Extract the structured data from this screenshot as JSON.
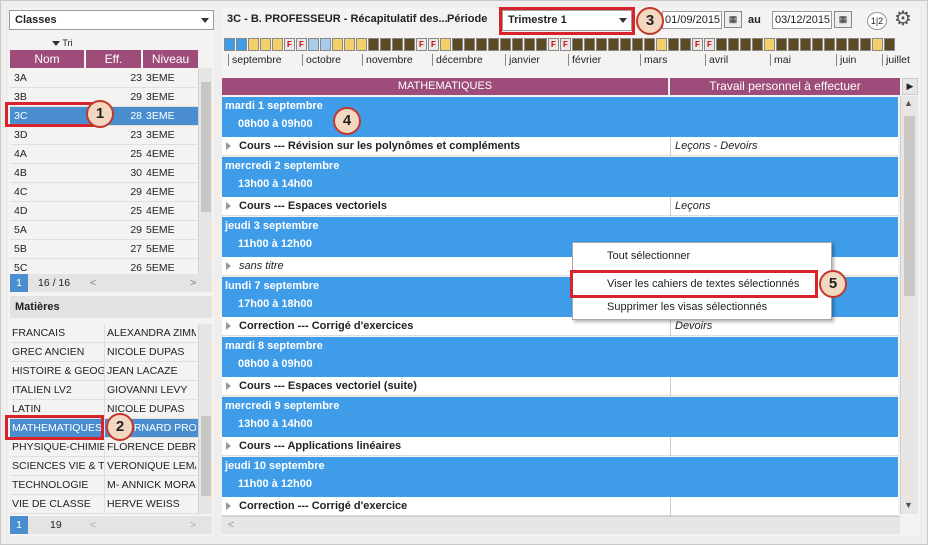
{
  "classes": {
    "dropdown_label": "Classes",
    "sort_label": "Tri",
    "columns": [
      "Nom",
      "Eff.",
      "Niveau"
    ],
    "rows": [
      {
        "nom": "3A",
        "eff": "23",
        "niveau": "3EME"
      },
      {
        "nom": "3B",
        "eff": "29",
        "niveau": "3EME"
      },
      {
        "nom": "3C",
        "eff": "28",
        "niveau": "3EME"
      },
      {
        "nom": "3D",
        "eff": "23",
        "niveau": "3EME"
      },
      {
        "nom": "4A",
        "eff": "25",
        "niveau": "4EME"
      },
      {
        "nom": "4B",
        "eff": "30",
        "niveau": "4EME"
      },
      {
        "nom": "4C",
        "eff": "29",
        "niveau": "4EME"
      },
      {
        "nom": "4D",
        "eff": "25",
        "niveau": "4EME"
      },
      {
        "nom": "5A",
        "eff": "29",
        "niveau": "5EME"
      },
      {
        "nom": "5B",
        "eff": "27",
        "niveau": "5EME"
      },
      {
        "nom": "5C",
        "eff": "26",
        "niveau": "5EME"
      }
    ],
    "selected_index": 2,
    "footer_selected": "1",
    "footer_count": "16 / 16"
  },
  "matieres": {
    "header": "Matières",
    "rows": [
      {
        "matiere": "FRANCAIS",
        "prof": "ALEXANDRA ZIMM"
      },
      {
        "matiere": "GREC ANCIEN",
        "prof": "NICOLE DUPAS"
      },
      {
        "matiere": "HISTOIRE & GEOG",
        "prof": "JEAN LACAZE"
      },
      {
        "matiere": "ITALIEN LV2",
        "prof": "GIOVANNI LEVY"
      },
      {
        "matiere": "LATIN",
        "prof": "NICOLE DUPAS"
      },
      {
        "matiere": "MATHEMATIQUES",
        "prof": "B. BERNARD PROFES"
      },
      {
        "matiere": "PHYSIQUE-CHIMIE",
        "prof": "FLORENCE DEBRA"
      },
      {
        "matiere": "SCIENCES VIE & T",
        "prof": "VERONIQUE LEMA"
      },
      {
        "matiere": "TECHNOLOGIE",
        "prof": "M- ANNICK MORAI"
      },
      {
        "matiere": "VIE DE CLASSE",
        "prof": "HERVE WEISS"
      }
    ],
    "selected_index": 5,
    "footer_selected": "1",
    "footer_count": "19"
  },
  "toolbar": {
    "title": "3C - B. PROFESSEUR - Récapitulatif des...",
    "periode_label": "Période",
    "periode_value": "Trimestre 1",
    "date_from": "01/09/2015",
    "au_label": "au",
    "date_to": "03/12/2015",
    "split_icon": "1|2"
  },
  "months": [
    "septembre",
    "octobre",
    "novembre",
    "décembre",
    "janvier",
    "février",
    "mars",
    "avril",
    "mai",
    "juin",
    "juillet"
  ],
  "holiday_marker": "F",
  "list": {
    "col_subject": "MATHEMATIQUES",
    "col_work": "Travail personnel à effectuer",
    "days": [
      {
        "date": "mardi 1 septembre",
        "time": "08h00 à 09h00",
        "content": "Cours --- Révision sur les polynômes et compléments",
        "work": "Leçons - Devoirs",
        "italic": false
      },
      {
        "date": "mercredi 2 septembre",
        "time": "13h00 à 14h00",
        "content": "Cours --- Espaces vectoriels",
        "work": "Leçons",
        "italic": false
      },
      {
        "date": "jeudi 3 septembre",
        "time": "11h00 à 12h00",
        "content": "sans titre",
        "work": "",
        "italic": true
      },
      {
        "date": "lundi 7 septembre",
        "time": "17h00 à 18h00",
        "content": "Correction --- Corrigé d'exercices",
        "work": "Devoirs",
        "italic": false
      },
      {
        "date": "mardi 8 septembre",
        "time": "08h00 à 09h00",
        "content": "Cours --- Espaces vectoriel (suite)",
        "work": "",
        "italic": false
      },
      {
        "date": "mercredi 9 septembre",
        "time": "13h00 à 14h00",
        "content": "Cours --- Applications linéaires",
        "work": "",
        "italic": false
      },
      {
        "date": "jeudi 10 septembre",
        "time": "11h00 à 12h00",
        "content": "Correction --- Corrigé d'exercice",
        "work": "",
        "italic": false
      }
    ]
  },
  "context_menu": {
    "items": [
      "Tout sélectionner",
      "Viser les cahiers de textes sélectionnés",
      "Supprimer les visas sélectionnés"
    ]
  },
  "callouts": [
    "1",
    "2",
    "3",
    "4",
    "5"
  ],
  "colors": {
    "accent_header": "#9e4d7a",
    "selection": "#4a8ed0",
    "day_header": "#3e9ce8",
    "highlight_box": "#d9232a"
  }
}
